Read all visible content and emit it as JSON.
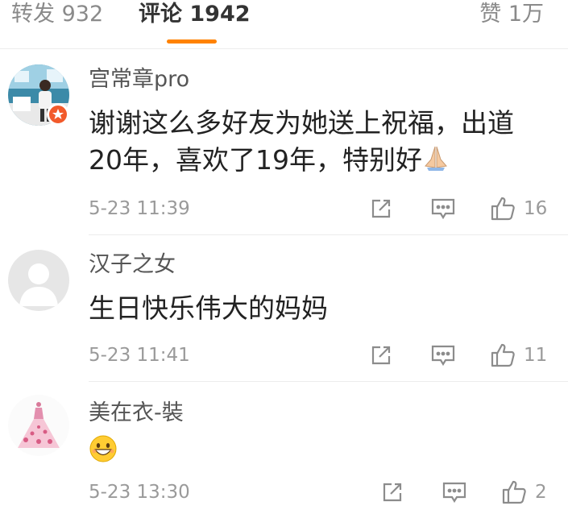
{
  "tabs": {
    "repost": "转发 932",
    "comments": "评论 1942",
    "likes": "赞 1万"
  },
  "accent_color": "#ff8200",
  "comments": [
    {
      "username": "宫常章pro",
      "text": "谢谢这么多好友为她送上祝福，出道20年，喜欢了19年，特别好",
      "emoji": "folded-hands-emoji",
      "time": "5-23 11:39",
      "like_count": "16"
    },
    {
      "username": "汉子之女",
      "text": "生日快乐伟大的妈妈",
      "time": "5-23 11:41",
      "like_count": "11"
    },
    {
      "username": "美在衣-裝",
      "text": "",
      "emoji": "grinning-face-emoji",
      "time": "5-23 13:30",
      "like_count": "2"
    }
  ]
}
